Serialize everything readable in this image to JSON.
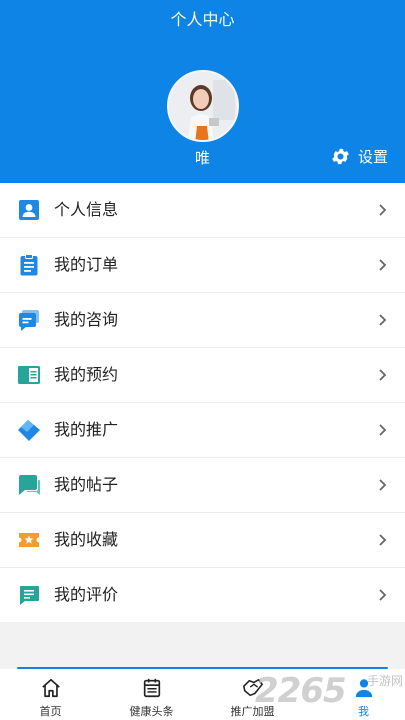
{
  "header": {
    "title": "个人中心",
    "username": "唯",
    "settings_label": "设置"
  },
  "menu": {
    "items": [
      {
        "label": "个人信息",
        "icon": "person-card-icon",
        "color": "#1e88e5"
      },
      {
        "label": "我的订单",
        "icon": "clipboard-icon",
        "color": "#1e88e5"
      },
      {
        "label": "我的咨询",
        "icon": "chat-bubble-icon",
        "color": "#1e88e5"
      },
      {
        "label": "我的预约",
        "icon": "book-icon",
        "color": "#26a69a"
      },
      {
        "label": "我的推广",
        "icon": "tag-icon",
        "color": "#1e88e5"
      },
      {
        "label": "我的帖子",
        "icon": "message-icon",
        "color": "#26a69a"
      },
      {
        "label": "我的收藏",
        "icon": "star-ticket-icon",
        "color": "#f39c2b"
      },
      {
        "label": "我的评价",
        "icon": "comment-icon",
        "color": "#26a69a"
      }
    ]
  },
  "tabbar": {
    "tabs": [
      {
        "label": "首页",
        "icon": "home-icon"
      },
      {
        "label": "健康头条",
        "icon": "calendar-news-icon"
      },
      {
        "label": "推广加盟",
        "icon": "handshake-icon"
      },
      {
        "label": "我",
        "icon": "person-icon",
        "active": true
      }
    ]
  },
  "watermark": {
    "big": "2265",
    "small": "手游网"
  },
  "colors": {
    "primary": "#0d84e6",
    "background": "#f2f2f2"
  }
}
